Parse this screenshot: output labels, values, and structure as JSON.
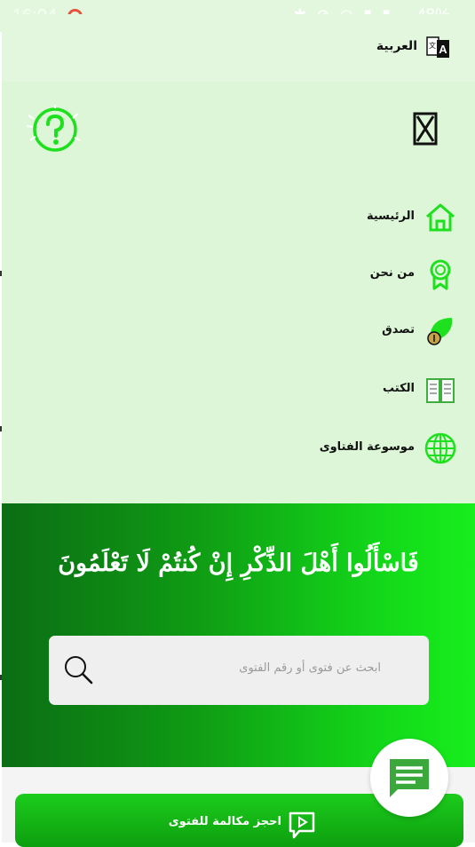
{
  "status_bar": {
    "time": "16:04",
    "battery": "48%",
    "signal_icons": "✱ ⊘ ◠ ▮ ▮"
  },
  "drawer": {
    "language_label": "العربية",
    "menu": [
      {
        "label": "الرئيسية",
        "icon": "home-icon"
      },
      {
        "label": "من نحن",
        "icon": "badge-icon"
      },
      {
        "label": "تصدق",
        "icon": "donate-icon"
      },
      {
        "label": "الكتب",
        "icon": "book-icon"
      },
      {
        "label": "موسوعة الفتاوى",
        "icon": "globe-icon"
      }
    ]
  },
  "hero": {
    "verse": "فَاسْأَلُوا أَهْلَ الذِّكْرِ إِنْ كُنتُمْ لَا تَعْلَمُونَ",
    "search_placeholder": "ابحث عن فتوى أو رقم الفتوى"
  },
  "booking": {
    "label": "احجز مكالمة للفتوى"
  },
  "colors": {
    "accent": "#1fe01f",
    "drawer_bg": "#dcf6d7",
    "hero_dark": "#0b6d14",
    "hero_light": "#17ee1c"
  }
}
